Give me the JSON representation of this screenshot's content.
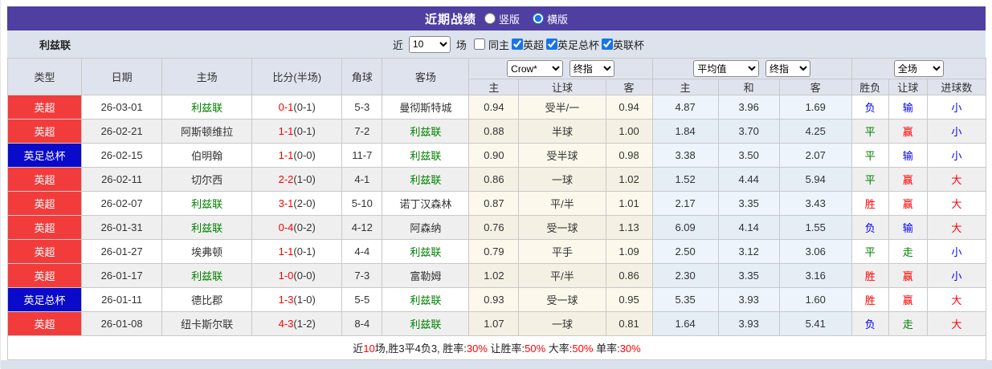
{
  "header": {
    "title": "近期战绩",
    "radios": [
      {
        "label": "竖版",
        "checked": false
      },
      {
        "label": "横版",
        "checked": true
      }
    ]
  },
  "toolbar": {
    "team": "利兹联",
    "recent_label": "近",
    "recent_count": "10",
    "matches_label": "场",
    "checkboxes": [
      {
        "label": "同主",
        "checked": false
      },
      {
        "label": "英超",
        "checked": true
      },
      {
        "label": "英足总杯",
        "checked": true
      },
      {
        "label": "英联杯",
        "checked": true
      }
    ]
  },
  "table": {
    "columns": [
      "类型",
      "日期",
      "主场",
      "比分(半场)",
      "角球",
      "客场"
    ],
    "sub_columns": [
      "主",
      "让球",
      "客",
      "主",
      "和",
      "客",
      "胜负",
      "让球",
      "进球数"
    ],
    "selects": {
      "bookmaker": "Crow*",
      "index1": "终指",
      "average": "平均值",
      "index2": "终指",
      "full": "全场"
    },
    "rows": [
      {
        "league": "英超",
        "league_color": "red",
        "date": "26-03-01",
        "home": "利兹联",
        "home_team": true,
        "score": "0-1",
        "half": "(0-1)",
        "corner": "5-3",
        "away": "曼彻斯特城",
        "away_team": false,
        "odds1": [
          "0.94",
          "受半/一",
          "0.94"
        ],
        "odds2": [
          "4.87",
          "3.96",
          "1.69"
        ],
        "results": [
          {
            "t": "负",
            "c": "blue"
          },
          {
            "t": "输",
            "c": "blue"
          },
          {
            "t": "小",
            "c": "blue"
          }
        ]
      },
      {
        "league": "英超",
        "league_color": "red",
        "date": "26-02-21",
        "home": "阿斯顿维拉",
        "home_team": false,
        "score": "1-1",
        "half": "(0-1)",
        "corner": "7-2",
        "away": "利兹联",
        "away_team": true,
        "odds1": [
          "0.88",
          "半球",
          "1.00"
        ],
        "odds2": [
          "1.84",
          "3.70",
          "4.25"
        ],
        "results": [
          {
            "t": "平",
            "c": "green"
          },
          {
            "t": "赢",
            "c": "red"
          },
          {
            "t": "小",
            "c": "blue"
          }
        ]
      },
      {
        "league": "英足总杯",
        "league_color": "blue",
        "date": "26-02-15",
        "home": "伯明翰",
        "home_team": false,
        "score": "1-1",
        "half": "(0-0)",
        "corner": "11-7",
        "away": "利兹联",
        "away_team": true,
        "odds1": [
          "0.90",
          "受半球",
          "0.98"
        ],
        "odds2": [
          "3.38",
          "3.50",
          "2.07"
        ],
        "results": [
          {
            "t": "平",
            "c": "green"
          },
          {
            "t": "输",
            "c": "blue"
          },
          {
            "t": "小",
            "c": "blue"
          }
        ]
      },
      {
        "league": "英超",
        "league_color": "red",
        "date": "26-02-11",
        "home": "切尔西",
        "home_team": false,
        "score": "2-2",
        "half": "(1-0)",
        "corner": "4-1",
        "away": "利兹联",
        "away_team": true,
        "odds1": [
          "0.86",
          "一球",
          "1.02"
        ],
        "odds2": [
          "1.52",
          "4.44",
          "5.94"
        ],
        "results": [
          {
            "t": "平",
            "c": "green"
          },
          {
            "t": "赢",
            "c": "red"
          },
          {
            "t": "大",
            "c": "red"
          }
        ]
      },
      {
        "league": "英超",
        "league_color": "red",
        "date": "26-02-07",
        "home": "利兹联",
        "home_team": true,
        "score": "3-1",
        "half": "(2-0)",
        "corner": "5-10",
        "away": "诺丁汉森林",
        "away_team": false,
        "odds1": [
          "0.87",
          "平/半",
          "1.01"
        ],
        "odds2": [
          "2.17",
          "3.35",
          "3.43"
        ],
        "results": [
          {
            "t": "胜",
            "c": "red"
          },
          {
            "t": "赢",
            "c": "red"
          },
          {
            "t": "大",
            "c": "red"
          }
        ]
      },
      {
        "league": "英超",
        "league_color": "red",
        "date": "26-01-31",
        "home": "利兹联",
        "home_team": true,
        "score": "0-4",
        "half": "(0-2)",
        "corner": "4-12",
        "away": "阿森纳",
        "away_team": false,
        "odds1": [
          "0.76",
          "受一球",
          "1.13"
        ],
        "odds2": [
          "6.09",
          "4.14",
          "1.55"
        ],
        "results": [
          {
            "t": "负",
            "c": "blue"
          },
          {
            "t": "输",
            "c": "blue"
          },
          {
            "t": "大",
            "c": "red"
          }
        ]
      },
      {
        "league": "英超",
        "league_color": "red",
        "date": "26-01-27",
        "home": "埃弗顿",
        "home_team": false,
        "score": "1-1",
        "half": "(0-1)",
        "corner": "4-4",
        "away": "利兹联",
        "away_team": true,
        "odds1": [
          "0.79",
          "平手",
          "1.09"
        ],
        "odds2": [
          "2.50",
          "3.12",
          "3.06"
        ],
        "results": [
          {
            "t": "平",
            "c": "green"
          },
          {
            "t": "走",
            "c": "green"
          },
          {
            "t": "小",
            "c": "blue"
          }
        ]
      },
      {
        "league": "英超",
        "league_color": "red",
        "date": "26-01-17",
        "home": "利兹联",
        "home_team": true,
        "score": "1-0",
        "half": "(0-0)",
        "corner": "7-3",
        "away": "富勒姆",
        "away_team": false,
        "odds1": [
          "1.02",
          "平/半",
          "0.86"
        ],
        "odds2": [
          "2.30",
          "3.35",
          "3.16"
        ],
        "results": [
          {
            "t": "胜",
            "c": "red"
          },
          {
            "t": "赢",
            "c": "red"
          },
          {
            "t": "小",
            "c": "blue"
          }
        ]
      },
      {
        "league": "英足总杯",
        "league_color": "blue",
        "date": "26-01-11",
        "home": "德比郡",
        "home_team": false,
        "score": "1-3",
        "half": "(1-0)",
        "corner": "5-5",
        "away": "利兹联",
        "away_team": true,
        "odds1": [
          "0.93",
          "受一球",
          "0.95"
        ],
        "odds2": [
          "5.35",
          "3.93",
          "1.60"
        ],
        "results": [
          {
            "t": "胜",
            "c": "red"
          },
          {
            "t": "赢",
            "c": "red"
          },
          {
            "t": "大",
            "c": "red"
          }
        ]
      },
      {
        "league": "英超",
        "league_color": "red",
        "date": "26-01-08",
        "home": "纽卡斯尔联",
        "home_team": false,
        "score": "4-3",
        "half": "(1-2)",
        "corner": "8-4",
        "away": "利兹联",
        "away_team": true,
        "odds1": [
          "1.07",
          "一球",
          "0.81"
        ],
        "odds2": [
          "1.64",
          "3.93",
          "5.41"
        ],
        "results": [
          {
            "t": "负",
            "c": "blue"
          },
          {
            "t": "走",
            "c": "green"
          },
          {
            "t": "大",
            "c": "red"
          }
        ]
      }
    ]
  },
  "footer": {
    "segments": [
      {
        "text": "近",
        "red": false
      },
      {
        "text": "10",
        "red": true
      },
      {
        "text": "场,胜3平4负3, 胜率:",
        "red": false
      },
      {
        "text": "30%",
        "red": true
      },
      {
        "text": " 让胜率:",
        "red": false
      },
      {
        "text": "50%",
        "red": true
      },
      {
        "text": " 大率:",
        "red": false
      },
      {
        "text": "50%",
        "red": true
      },
      {
        "text": " 单率:",
        "red": false
      },
      {
        "text": "30%",
        "red": true
      }
    ]
  },
  "colors": {
    "accent_purple": "#4f3fa0",
    "toolbar_bg": "#dce3ed",
    "header_bg": "#dfe3ee",
    "badge_red": "#f23c3c",
    "badge_blue": "#0a0acb",
    "win_red": "#ff0000",
    "draw_green": "#008000",
    "lose_blue": "#0000ff",
    "team_green": "#008000",
    "crow_col_bg": "#fcf8ec",
    "avg_col_bg": "#edf4fb"
  }
}
